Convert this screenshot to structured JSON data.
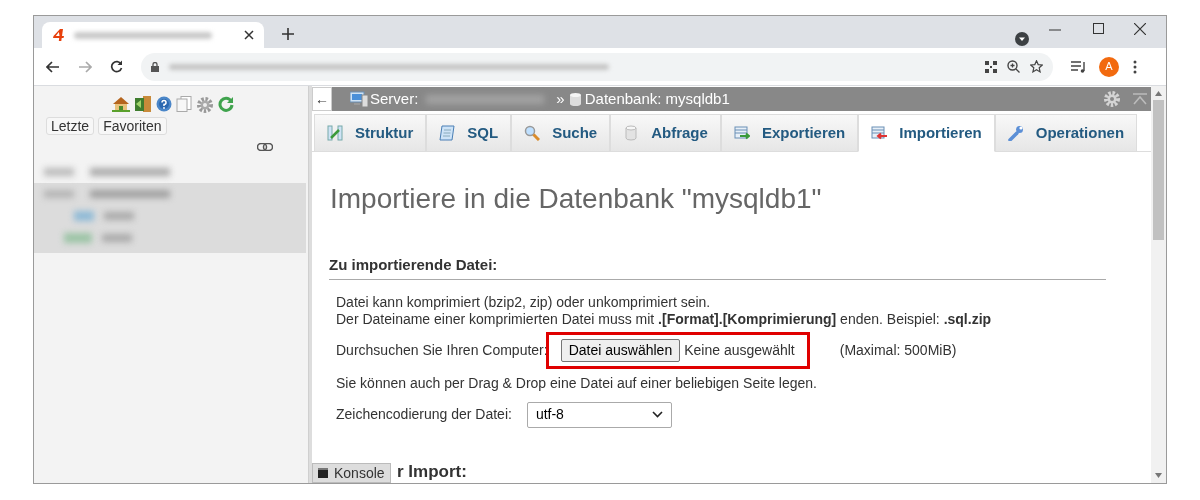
{
  "navigation": {
    "tabs": [
      {
        "label": "Letzte"
      },
      {
        "label": "Favoriten"
      }
    ]
  },
  "breadcrumb": {
    "back": "←",
    "server_label": "Server:",
    "separator": "»",
    "database": "Datenbank: mysqldb1"
  },
  "tabs": [
    {
      "label": "Struktur",
      "selected": false
    },
    {
      "label": "SQL",
      "selected": false
    },
    {
      "label": "Suche",
      "selected": false
    },
    {
      "label": "Abfrage",
      "selected": false
    },
    {
      "label": "Exportieren",
      "selected": false
    },
    {
      "label": "Importieren",
      "selected": true
    },
    {
      "label": "Operationen",
      "selected": false
    }
  ],
  "heading": "Importiere in die Datenbank \"mysqldb1\"",
  "section": {
    "title": "Zu importierende Datei:",
    "notes": [
      "Datei kann komprimiert (bzip2, zip) oder unkomprimiert sein.",
      "Der Dateiname einer komprimierten Datei muss mit **.[Format].[Komprimierung]** enden. Beispiel: **.sql.zip**"
    ],
    "browse_label": "Durchsuchen Sie Ihren Computer:",
    "file_button": "Datei auswählen",
    "file_status": "Keine ausgewählt",
    "file_highlighted": true,
    "max_size": "(Maximal: 500MiB)",
    "drag_hint": "Sie können auch per Drag & Drop eine Datei auf einer beliebigen Seite legen.",
    "encoding_label": "Zeichencodierung der Datei:",
    "encoding_value": "utf-8"
  },
  "next_section_title": "r Import:",
  "console_button": "Konsole",
  "avatar": "A"
}
